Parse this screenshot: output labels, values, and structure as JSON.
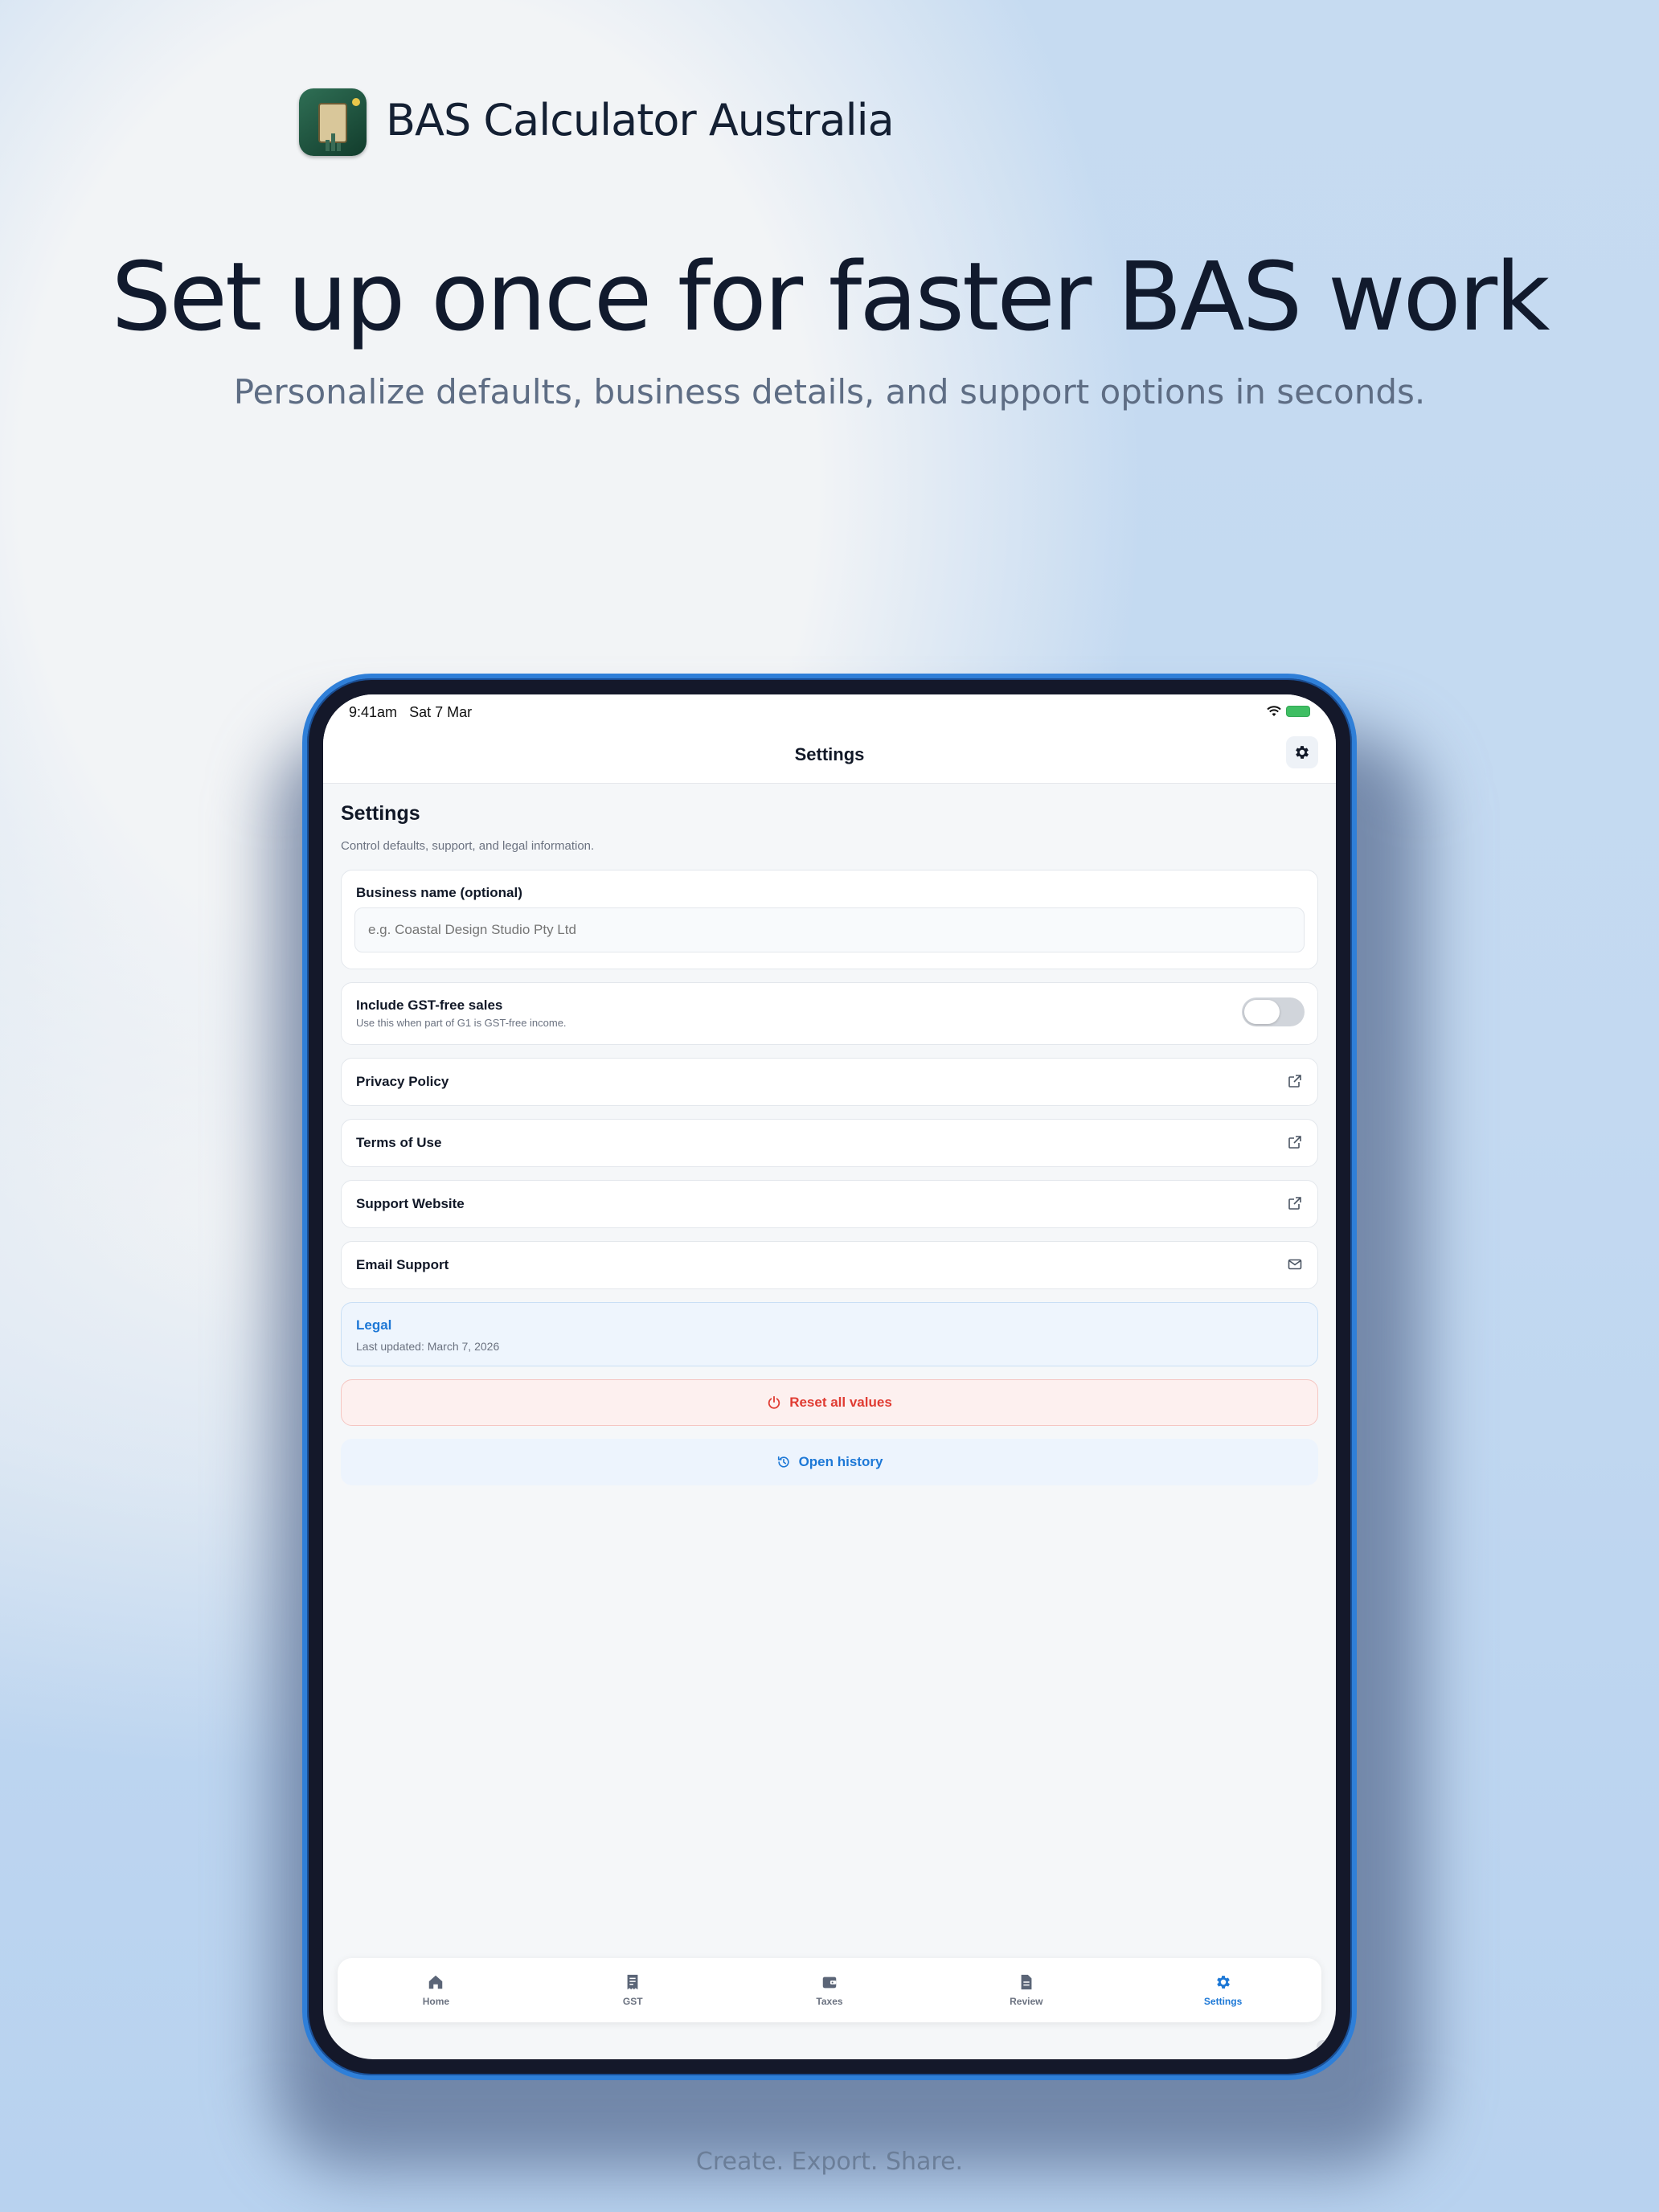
{
  "marketing": {
    "app_name": "BAS Calculator Australia",
    "headline": "Set up once for faster BAS work",
    "subheadline": "Personalize defaults, business details, and support options in seconds.",
    "footer_tagline": "Create. Export. Share."
  },
  "status_bar": {
    "time": "9:41am",
    "date": "Sat 7 Mar"
  },
  "nav": {
    "title": "Settings",
    "gear_icon": "gear-icon"
  },
  "page": {
    "title": "Settings",
    "description": "Control defaults, support, and legal information."
  },
  "business_name": {
    "label": "Business name (optional)",
    "value": "",
    "placeholder": "e.g. Coastal Design Studio Pty Ltd"
  },
  "gst_free": {
    "label": "Include GST-free sales",
    "hint": "Use this when part of G1 is GST-free income.",
    "enabled": false
  },
  "links": [
    {
      "label": "Privacy Policy",
      "icon": "external-link-icon"
    },
    {
      "label": "Terms of Use",
      "icon": "external-link-icon"
    },
    {
      "label": "Support Website",
      "icon": "external-link-icon"
    },
    {
      "label": "Email Support",
      "icon": "mail-icon"
    }
  ],
  "legal": {
    "title": "Legal",
    "updated": "Last updated: March 7, 2026"
  },
  "actions": {
    "reset_label": "Reset all values",
    "history_label": "Open history"
  },
  "tabs": [
    {
      "label": "Home",
      "icon": "home-icon",
      "active": false
    },
    {
      "label": "GST",
      "icon": "receipt-icon",
      "active": false
    },
    {
      "label": "Taxes",
      "icon": "wallet-icon",
      "active": false
    },
    {
      "label": "Review",
      "icon": "document-icon",
      "active": false
    },
    {
      "label": "Settings",
      "icon": "gear-icon",
      "active": true
    }
  ],
  "colors": {
    "accent": "#1d78d6",
    "danger": "#e03b32",
    "device_frame": "#2f7fd8"
  }
}
